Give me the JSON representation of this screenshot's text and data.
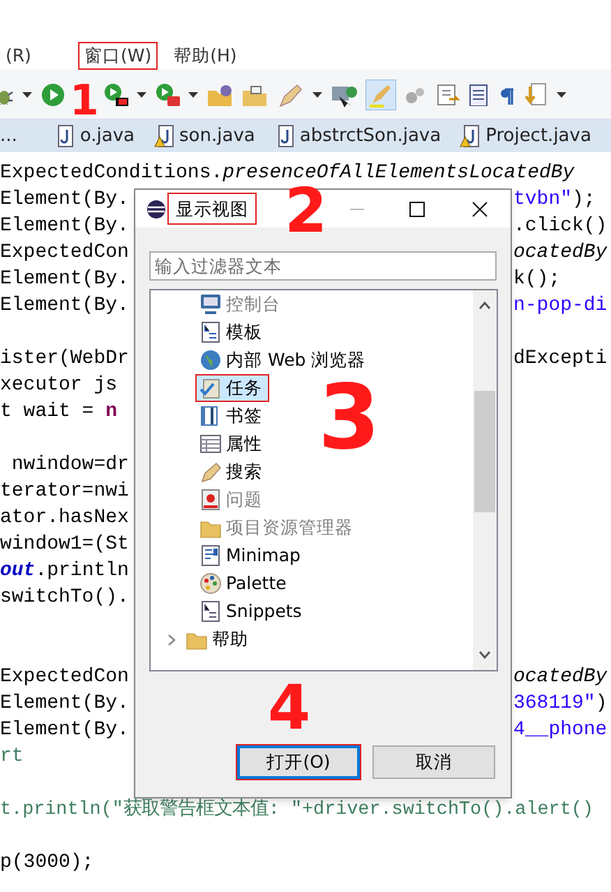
{
  "menu": [
    {
      "label": "(R)",
      "boxed": false
    },
    {
      "label": "窗口(W)",
      "boxed": true
    },
    {
      "label": "帮助(H)",
      "boxed": false
    }
  ],
  "cut_tab": "...",
  "tabs": [
    {
      "label": "o.java",
      "warning": false
    },
    {
      "label": "son.java",
      "warning": true
    },
    {
      "label": "abstrctSon.java",
      "warning": false
    },
    {
      "label": "Project.java",
      "warning": true
    }
  ],
  "code_lines": [
    {
      "kind": "code",
      "left": [
        {
          "t": "ExpectedConditions.",
          "kind": "plain"
        },
        {
          "t": "presenceOfAllElementsLocatedBy",
          "kind": "italic"
        }
      ]
    },
    {
      "kind": "code",
      "left": [
        {
          "t": "Element(By.",
          "kind": "plain"
        }
      ],
      "right": [
        {
          "t": "tvbn\"",
          "kind": "string"
        },
        {
          "t": ");",
          "kind": "plain"
        }
      ]
    },
    {
      "kind": "code",
      "left": [
        {
          "t": "Element(By.",
          "kind": "plain"
        }
      ],
      "right": [
        {
          "t": ".click()",
          "kind": "plain"
        }
      ]
    },
    {
      "kind": "code",
      "left": [
        {
          "t": "ExpectedCon",
          "kind": "plain"
        }
      ],
      "right": [
        {
          "t": "ocatedBy",
          "kind": "italic"
        }
      ]
    },
    {
      "kind": "code",
      "left": [
        {
          "t": "Element(By.",
          "kind": "plain"
        }
      ],
      "right": [
        {
          "t": "k();",
          "kind": "plain"
        }
      ]
    },
    {
      "kind": "code",
      "left": [
        {
          "t": "Element(By.",
          "kind": "plain"
        }
      ],
      "right": [
        {
          "t": "n-pop-di",
          "kind": "string"
        }
      ]
    },
    {
      "kind": "blank"
    },
    {
      "kind": "code",
      "left": [
        {
          "t": "ister(WebDr",
          "kind": "plain"
        }
      ],
      "right": [
        {
          "t": "dExcepti",
          "kind": "plain"
        }
      ]
    },
    {
      "kind": "code",
      "left": [
        {
          "t": "xecutor js",
          "kind": "plain"
        }
      ]
    },
    {
      "kind": "code",
      "left": [
        {
          "t": "t wait = ",
          "kind": "plain"
        },
        {
          "t": "n",
          "kind": "keyword"
        }
      ]
    },
    {
      "kind": "blank"
    },
    {
      "kind": "code",
      "left": [
        {
          "t": " nwindow=dr",
          "kind": "plain"
        }
      ]
    },
    {
      "kind": "code",
      "left": [
        {
          "t": "terator=nwi",
          "kind": "plain"
        }
      ]
    },
    {
      "kind": "code",
      "left": [
        {
          "t": "ator.hasNex",
          "kind": "plain"
        }
      ]
    },
    {
      "kind": "code",
      "left": [
        {
          "t": "window1=(St",
          "kind": "plain"
        }
      ]
    },
    {
      "kind": "code",
      "left": [
        {
          "t": "out",
          "kind": "field"
        },
        {
          "t": ".println",
          "kind": "plain"
        }
      ]
    },
    {
      "kind": "code",
      "left": [
        {
          "t": "switchTo().",
          "kind": "plain"
        }
      ]
    },
    {
      "kind": "blank"
    },
    {
      "kind": "blank"
    },
    {
      "kind": "code",
      "left": [
        {
          "t": "ExpectedCon",
          "kind": "plain"
        }
      ],
      "right": [
        {
          "t": "ocatedBy",
          "kind": "italic"
        }
      ]
    },
    {
      "kind": "code",
      "left": [
        {
          "t": "Element(By.",
          "kind": "plain"
        }
      ],
      "right": [
        {
          "t": "368119\"",
          "kind": "string"
        },
        {
          "t": ")",
          "kind": "plain"
        }
      ]
    },
    {
      "kind": "code",
      "left": [
        {
          "t": "Element(By.",
          "kind": "plain"
        }
      ],
      "right": [
        {
          "t": "4__phone",
          "kind": "string"
        }
      ]
    },
    {
      "kind": "code",
      "left": [
        {
          "t": "rt",
          "kind": "comment"
        }
      ]
    },
    {
      "kind": "blank"
    },
    {
      "kind": "code",
      "left": [
        {
          "t": "t.println(\"获取警告框文本值: \"+driver.switchTo().alert()",
          "kind": "comment"
        }
      ]
    },
    {
      "kind": "blank"
    },
    {
      "kind": "code",
      "left": [
        {
          "t": "p(3000);",
          "kind": "plain"
        }
      ]
    }
  ],
  "dialog": {
    "title": "显示视图",
    "title_boxed": true,
    "filter": {
      "placeholder": "输入过滤器文本"
    },
    "items": [
      {
        "kind": "view",
        "label": "控制台",
        "disabled": true,
        "selected": false,
        "boxed": false
      },
      {
        "kind": "view",
        "label": "模板",
        "disabled": false,
        "selected": false,
        "boxed": false
      },
      {
        "kind": "view",
        "label": "内部 Web 浏览器",
        "disabled": false,
        "selected": false,
        "boxed": false
      },
      {
        "kind": "view",
        "label": "任务",
        "disabled": false,
        "selected": true,
        "boxed": true
      },
      {
        "kind": "view",
        "label": "书签",
        "disabled": false,
        "selected": false,
        "boxed": false
      },
      {
        "kind": "view",
        "label": "属性",
        "disabled": false,
        "selected": false,
        "boxed": false
      },
      {
        "kind": "view",
        "label": "搜索",
        "disabled": false,
        "selected": false,
        "boxed": false
      },
      {
        "kind": "view",
        "label": "问题",
        "disabled": true,
        "selected": false,
        "boxed": false
      },
      {
        "kind": "view",
        "label": "项目资源管理器",
        "disabled": true,
        "selected": false,
        "boxed": false
      },
      {
        "kind": "view",
        "label": "Minimap",
        "disabled": false,
        "selected": false,
        "boxed": false
      },
      {
        "kind": "view",
        "label": "Palette",
        "disabled": false,
        "selected": false,
        "boxed": false
      },
      {
        "kind": "view",
        "label": "Snippets",
        "disabled": false,
        "selected": false,
        "boxed": false
      },
      {
        "kind": "folder",
        "label": "帮助",
        "disabled": false,
        "selected": false,
        "boxed": false
      }
    ],
    "buttons": [
      {
        "label": "打开(O)",
        "default": true,
        "boxed": true
      },
      {
        "label": "取消",
        "default": false,
        "boxed": false
      }
    ]
  },
  "annotations": [
    "1",
    "2",
    "3",
    "4"
  ]
}
